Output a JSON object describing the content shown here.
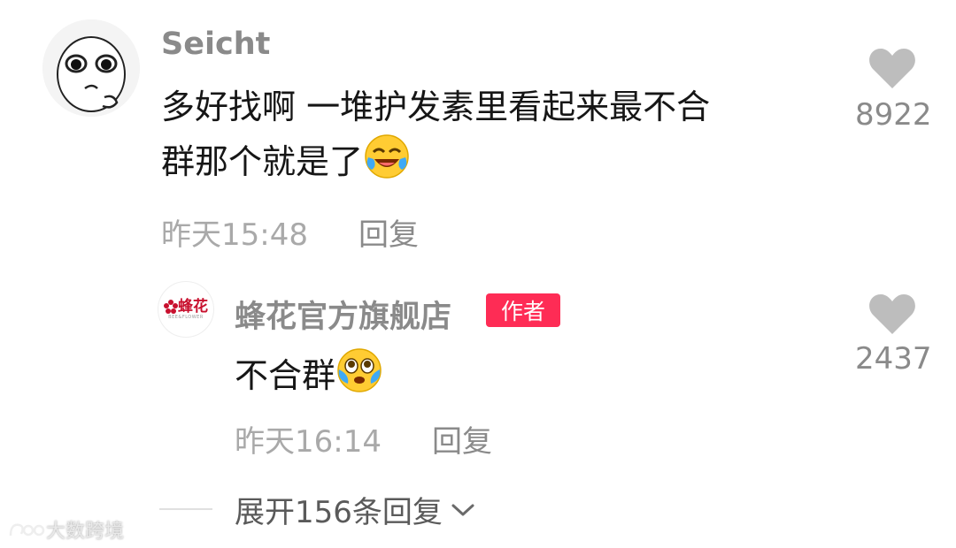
{
  "comment": {
    "username": "Seicht",
    "text_line1": "多好找啊 一堆护发素里看起来最不合",
    "text_line2": "群那个就是了",
    "emoji": "laugh-cry-emoji",
    "time": "昨天15:48",
    "reply_label": "回复",
    "likes": "8922"
  },
  "reply": {
    "username": "蜂花官方旗舰店",
    "avatar_text": "蜂花",
    "avatar_sub": "BEE&FLOWER",
    "badge": "作者",
    "text": "不合群",
    "emoji": "teary-emoji",
    "time": "昨天16:14",
    "reply_label": "回复",
    "likes": "2437"
  },
  "expand": {
    "label": "展开156条回复"
  },
  "watermark": {
    "text": "大数跨境"
  },
  "colors": {
    "badge": "#fe2c55",
    "heart": "#bdbdbd",
    "text": "#161616",
    "muted": "#a9a9a9"
  }
}
